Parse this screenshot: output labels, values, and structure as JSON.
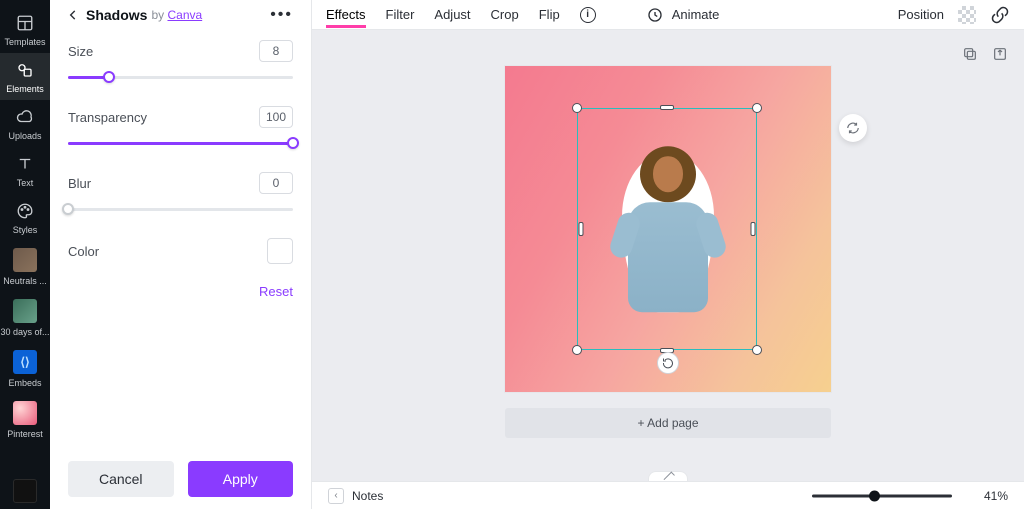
{
  "rail": {
    "items": [
      {
        "id": "templates",
        "label": "Templates",
        "icon": "layout-icon"
      },
      {
        "id": "elements",
        "label": "Elements",
        "icon": "shapes-icon"
      },
      {
        "id": "uploads",
        "label": "Uploads",
        "icon": "cloud-icon"
      },
      {
        "id": "text",
        "label": "Text",
        "icon": "text-icon"
      },
      {
        "id": "styles",
        "label": "Styles",
        "icon": "palette-icon"
      },
      {
        "id": "neutrals",
        "label": "Neutrals ..."
      },
      {
        "id": "30days",
        "label": "30 days of..."
      },
      {
        "id": "embeds",
        "label": "Embeds"
      },
      {
        "id": "pinterest",
        "label": "Pinterest"
      }
    ],
    "active": "elements"
  },
  "panel": {
    "title": "Shadows",
    "by_prefix": "by ",
    "brand": "Canva",
    "more_icon": "more-icon",
    "controls": {
      "size": {
        "label": "Size",
        "value": "8",
        "pct": 18
      },
      "transparency": {
        "label": "Transparency",
        "value": "100",
        "pct": 100
      },
      "blur": {
        "label": "Blur",
        "value": "0",
        "pct": 0
      },
      "color": {
        "label": "Color",
        "swatch": "#ffffff"
      }
    },
    "reset": "Reset",
    "cancel": "Cancel",
    "apply": "Apply"
  },
  "toolbar": {
    "tabs": [
      {
        "id": "effects",
        "label": "Effects"
      },
      {
        "id": "filter",
        "label": "Filter"
      },
      {
        "id": "adjust",
        "label": "Adjust"
      },
      {
        "id": "crop",
        "label": "Crop"
      },
      {
        "id": "flip",
        "label": "Flip"
      }
    ],
    "active": "effects",
    "info_icon": "info-icon",
    "animate_icon": "animate-icon",
    "animate": "Animate",
    "position": "Position",
    "transparency_icon": "transparency-icon",
    "link_icon": "link-icon"
  },
  "stage": {
    "duplicate_icon": "duplicate-icon",
    "export_icon": "export-icon",
    "regen_icon": "regen-icon",
    "rotate_icon": "rotate-icon",
    "add_page": "+ Add page"
  },
  "footer": {
    "notes": "Notes",
    "zoom_pct": 41,
    "zoom_label": "41%"
  }
}
